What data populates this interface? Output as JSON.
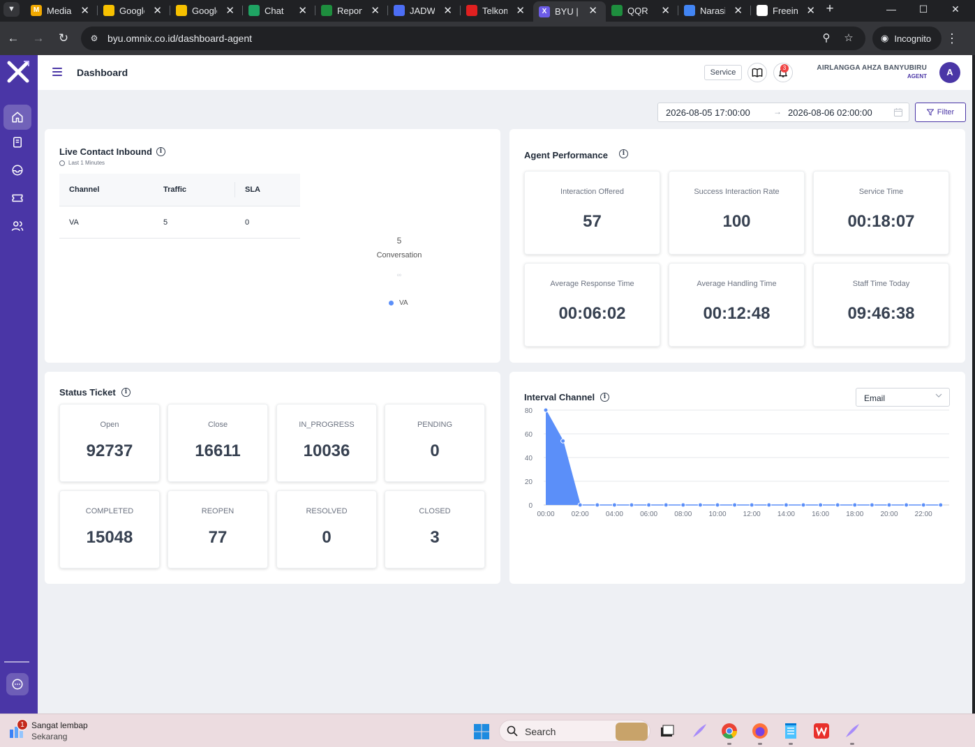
{
  "browser": {
    "tabs": [
      {
        "title": "Media",
        "favicon_color": "#f2a900",
        "favicon_glyph": "M",
        "active": false
      },
      {
        "title": "Google",
        "favicon_color": "#f7c100",
        "favicon_glyph": "",
        "active": false
      },
      {
        "title": "Google",
        "favicon_color": "#f7c100",
        "favicon_glyph": "",
        "active": false
      },
      {
        "title": "Chat",
        "favicon_color": "#1fa463",
        "favicon_glyph": "",
        "active": false
      },
      {
        "title": "Report",
        "favicon_color": "#1e8e3e",
        "favicon_glyph": "",
        "active": false
      },
      {
        "title": "JADWAL",
        "favicon_color": "#4c6ef5",
        "favicon_glyph": "",
        "active": false
      },
      {
        "title": "Telkomsel",
        "favicon_color": "#e02020",
        "favicon_glyph": "",
        "active": false
      },
      {
        "title": "BYU | Omnix",
        "favicon_color": "#6c5ce7",
        "favicon_glyph": "X",
        "active": true
      },
      {
        "title": "QQR",
        "favicon_color": "#1e8e3e",
        "favicon_glyph": "",
        "active": false
      },
      {
        "title": "Narasi",
        "favicon_color": "#4285f4",
        "favicon_glyph": "",
        "active": false
      },
      {
        "title": "Freein",
        "favicon_color": "#ffffff",
        "favicon_glyph": "",
        "active": false
      }
    ],
    "url": "byu.omnix.co.id/dashboard-agent",
    "incognito_label": "Incognito"
  },
  "app": {
    "page_title": "Dashboard",
    "service_label": "Service",
    "notification_count": "3",
    "user_name": "AIRLANGGA AHZA BANYUBIRU",
    "user_role": "AGENT",
    "avatar_initial": "A",
    "date_start": "2026-08-05 17:00:00",
    "date_end": "2026-08-06 02:00:00",
    "filter_label": "Filter",
    "accent_color": "#4a36a6"
  },
  "live_contact": {
    "title": "Live Contact Inbound",
    "subtitle": "Last 1 Minutes",
    "columns": [
      "Channel",
      "Traffic",
      "SLA"
    ],
    "rows": [
      [
        "VA",
        "5",
        "0"
      ]
    ],
    "total": "5",
    "total_label": "Conversation",
    "legend": "VA"
  },
  "agent_performance": {
    "title": "Agent Performance",
    "metrics": [
      {
        "label": "Interaction Offered",
        "value": "57"
      },
      {
        "label": "Success Interaction Rate",
        "value": "100"
      },
      {
        "label": "Service Time",
        "value": "00:18:07"
      },
      {
        "label": "Average Response Time",
        "value": "00:06:02"
      },
      {
        "label": "Average Handling Time",
        "value": "00:12:48"
      },
      {
        "label": "Staff Time Today",
        "value": "09:46:38"
      }
    ]
  },
  "status_ticket": {
    "title": "Status Ticket",
    "items": [
      {
        "label": "Open",
        "value": "92737"
      },
      {
        "label": "Close",
        "value": "16611"
      },
      {
        "label": "IN_PROGRESS",
        "value": "10036"
      },
      {
        "label": "PENDING",
        "value": "0"
      },
      {
        "label": "COMPLETED",
        "value": "15048"
      },
      {
        "label": "REOPEN",
        "value": "77"
      },
      {
        "label": "RESOLVED",
        "value": "0"
      },
      {
        "label": "CLOSED",
        "value": "3"
      }
    ]
  },
  "interval_channel": {
    "title": "Interval Channel",
    "selected_channel": "Email"
  },
  "chart_data": {
    "type": "area",
    "title": "Interval Channel",
    "xlabel": "",
    "ylabel": "",
    "x": [
      "00:00",
      "01:00",
      "02:00",
      "03:00",
      "04:00",
      "05:00",
      "06:00",
      "07:00",
      "08:00",
      "09:00",
      "10:00",
      "11:00",
      "12:00",
      "13:00",
      "14:00",
      "15:00",
      "16:00",
      "17:00",
      "18:00",
      "19:00",
      "20:00",
      "21:00",
      "22:00",
      "23:00"
    ],
    "x_tick_labels": [
      "00:00",
      "02:00",
      "04:00",
      "06:00",
      "08:00",
      "10:00",
      "12:00",
      "14:00",
      "16:00",
      "18:00",
      "20:00",
      "22:00"
    ],
    "series": [
      {
        "values": [
          80,
          54,
          0,
          0,
          0,
          0,
          0,
          0,
          0,
          0,
          0,
          0,
          0,
          0,
          0,
          0,
          0,
          0,
          0,
          0,
          0,
          0,
          0,
          0
        ],
        "color": "#5b8ff9"
      }
    ],
    "y_ticks": [
      0,
      20,
      40,
      60,
      80
    ],
    "ylim": [
      0,
      80
    ],
    "grid": true,
    "legend": "none"
  },
  "taskbar": {
    "notification_title": "Sangat lembap",
    "notification_subtitle": "Sekarang",
    "notification_badge": "1",
    "search_label": "Search"
  }
}
